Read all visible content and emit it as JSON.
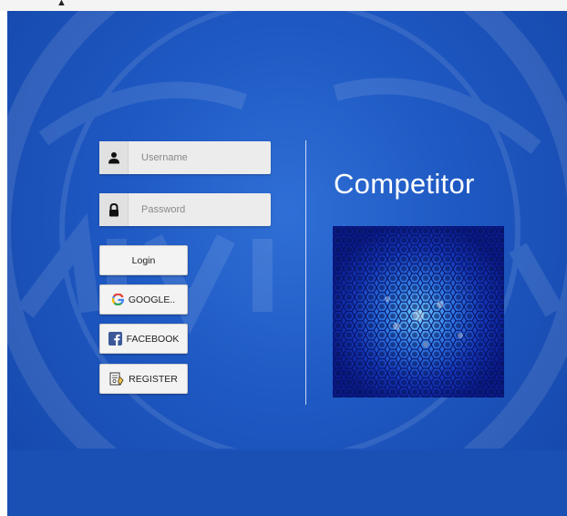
{
  "login_form": {
    "username_placeholder": "Username",
    "password_placeholder": "Password",
    "login_label": "Login"
  },
  "social": {
    "google_label": "GOOGLE..",
    "facebook_label": "FACEBOOK",
    "register_label": "REGISTER"
  },
  "brand": {
    "name": "Competitor"
  },
  "icons": {
    "username": "user-icon",
    "password": "lock-icon",
    "google": "google-icon",
    "facebook": "facebook-icon",
    "register": "register-icon"
  },
  "colors": {
    "background": "#1e58c2",
    "facebook": "#3b5998",
    "hero_dark": "#0b1e8e",
    "hero_light": "#59b8ff"
  }
}
